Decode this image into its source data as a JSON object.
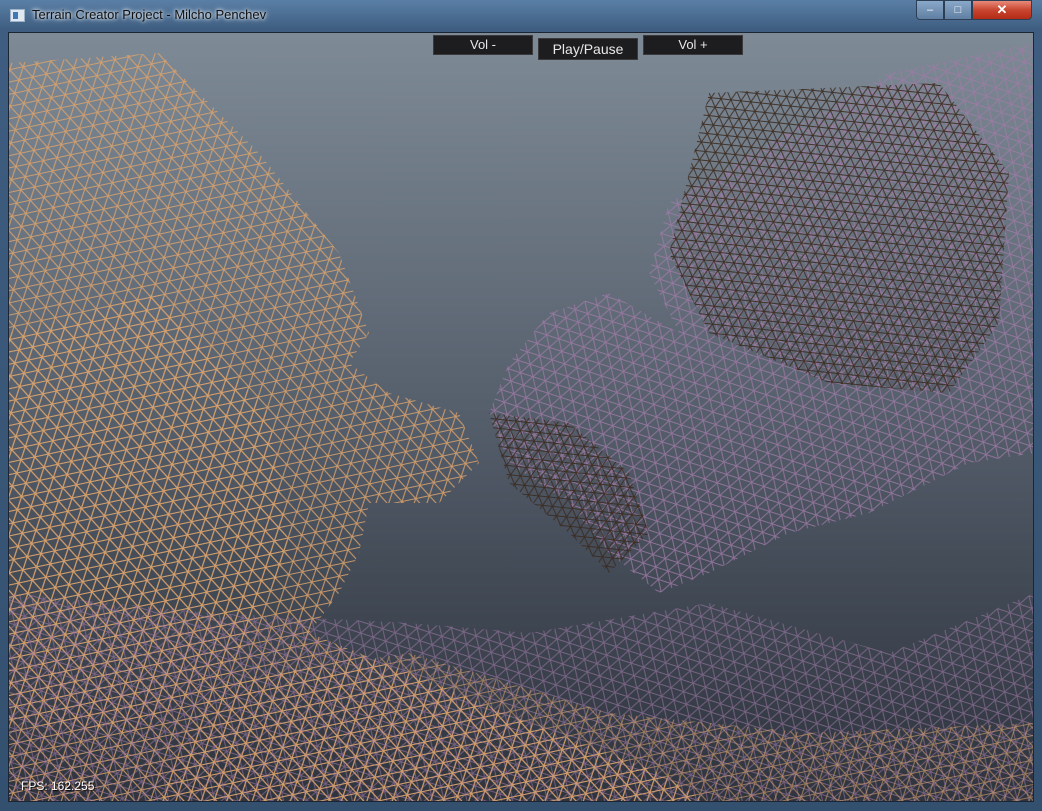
{
  "window": {
    "title": "Terrain Creator Project - Milcho Penchev",
    "controls": {
      "minimize": "–",
      "maximize": "□",
      "close": "✕"
    }
  },
  "toolbar": {
    "vol_down": "Vol -",
    "play_pause": "Play/Pause",
    "vol_up": "Vol +"
  },
  "status": {
    "fps": "FPS: 162.255"
  },
  "scene": {
    "description_colors": {
      "sky_top": "#7e8a96",
      "sky_bottom": "#2f343e",
      "mesh_warm": "#d9a46a",
      "mesh_cool": "#9a7aa0",
      "mesh_dark": "#3a2a20"
    }
  }
}
